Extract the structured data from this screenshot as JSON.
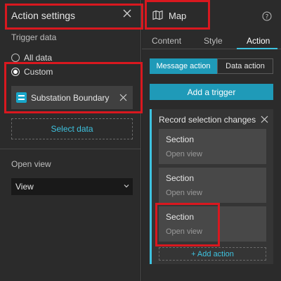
{
  "left_panel": {
    "title": "Action settings",
    "trigger_data_label": "Trigger data",
    "radio_all": "All data",
    "radio_custom": "Custom",
    "data_source": "Substation Boundary",
    "select_data": "Select data",
    "open_view_label": "Open view",
    "view_value": "View"
  },
  "right_panel": {
    "title": "Map",
    "tabs": [
      "Content",
      "Style",
      "Action"
    ],
    "active_tab": "Action",
    "segment": {
      "message": "Message action",
      "data": "Data action"
    },
    "add_trigger": "Add a trigger",
    "trigger_title": "Record selection changes",
    "actions": [
      {
        "title": "Section",
        "subtitle": "Open view"
      },
      {
        "title": "Section",
        "subtitle": "Open view"
      },
      {
        "title": "Section",
        "subtitle": "Open view"
      }
    ],
    "add_action": "+ Add action"
  },
  "colors": {
    "accent": "#1f9ab8",
    "link": "#3ec3e0",
    "highlight": "#d9181f"
  }
}
